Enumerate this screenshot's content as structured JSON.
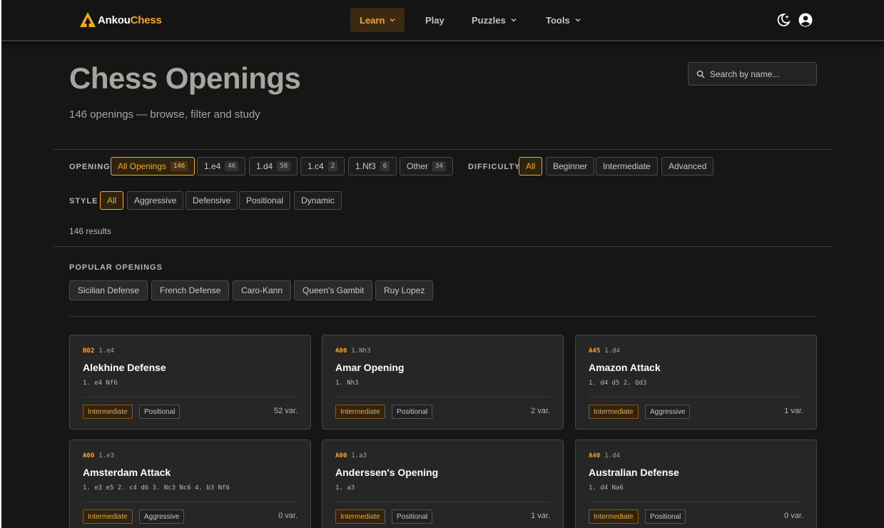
{
  "brand": {
    "name_part1": "Ankou",
    "name_part2": "Chess"
  },
  "nav": {
    "items": [
      {
        "label": "Learn",
        "active": true,
        "dropdown": true
      },
      {
        "label": "Play",
        "active": false,
        "dropdown": false
      },
      {
        "label": "Puzzles",
        "active": false,
        "dropdown": true
      },
      {
        "label": "Tools",
        "active": false,
        "dropdown": true
      }
    ],
    "icons": [
      "theme-toggle-icon",
      "user-account-icon"
    ]
  },
  "hero": {
    "title": "Chess Openings",
    "subtitle": "146 openings — browse, filter and study"
  },
  "search": {
    "placeholder": "Search by name..."
  },
  "filters": {
    "opening_label": "OPENING",
    "openings": [
      {
        "label": "All Openings",
        "count": "146",
        "active": true
      },
      {
        "label": "1.e4",
        "count": "46",
        "active": false
      },
      {
        "label": "1.d4",
        "count": "58",
        "active": false
      },
      {
        "label": "1.c4",
        "count": "2",
        "active": false
      },
      {
        "label": "1.Nf3",
        "count": "6",
        "active": false
      },
      {
        "label": "Other",
        "count": "34",
        "active": false
      }
    ],
    "difficulty_label": "DIFFICULTY",
    "difficulty": [
      {
        "label": "All",
        "active": true
      },
      {
        "label": "Beginner",
        "active": false
      },
      {
        "label": "Intermediate",
        "active": false
      },
      {
        "label": "Advanced",
        "active": false
      }
    ],
    "style_label": "STYLE",
    "style": [
      {
        "label": "All",
        "active": true
      },
      {
        "label": "Aggressive",
        "active": false
      },
      {
        "label": "Defensive",
        "active": false
      },
      {
        "label": "Positional",
        "active": false
      },
      {
        "label": "Dynamic",
        "active": false
      }
    ]
  },
  "results_text": "146 results",
  "popular": {
    "label": "POPULAR OPENINGS",
    "items": [
      "Sicilian Defense",
      "French Defense",
      "Caro-Kann",
      "Queen's Gambit",
      "Ruy Lopez"
    ]
  },
  "cards": [
    {
      "eco": "B02",
      "first": "1.e4",
      "name": "Alekhine Defense",
      "moves": "1. e4 Nf6",
      "difficulty": "Intermediate",
      "style": "Positional",
      "variations": "52 var."
    },
    {
      "eco": "A00",
      "first": "1.Nh3",
      "name": "Amar Opening",
      "moves": "1. Nh3",
      "difficulty": "Intermediate",
      "style": "Positional",
      "variations": "2 var."
    },
    {
      "eco": "A45",
      "first": "1.d4",
      "name": "Amazon Attack",
      "moves": "1. d4 d5 2. Qd3",
      "difficulty": "Intermediate",
      "style": "Aggressive",
      "variations": "1 var."
    },
    {
      "eco": "A00",
      "first": "1.e3",
      "name": "Amsterdam Attack",
      "moves": "1. e3 e5 2. c4 d6 3. Nc3 Nc6 4. b3 Nf6",
      "difficulty": "Intermediate",
      "style": "Aggressive",
      "variations": "0 var."
    },
    {
      "eco": "A00",
      "first": "1.a3",
      "name": "Anderssen's Opening",
      "moves": "1. a3",
      "difficulty": "Intermediate",
      "style": "Positional",
      "variations": "1 var."
    },
    {
      "eco": "A40",
      "first": "1.d4",
      "name": "Australian Defense",
      "moves": "1. d4 Na6",
      "difficulty": "Intermediate",
      "style": "Positional",
      "variations": "0 var."
    }
  ],
  "colors": {
    "accent": "#f5a623",
    "background": "#161616",
    "card": "#262626"
  }
}
